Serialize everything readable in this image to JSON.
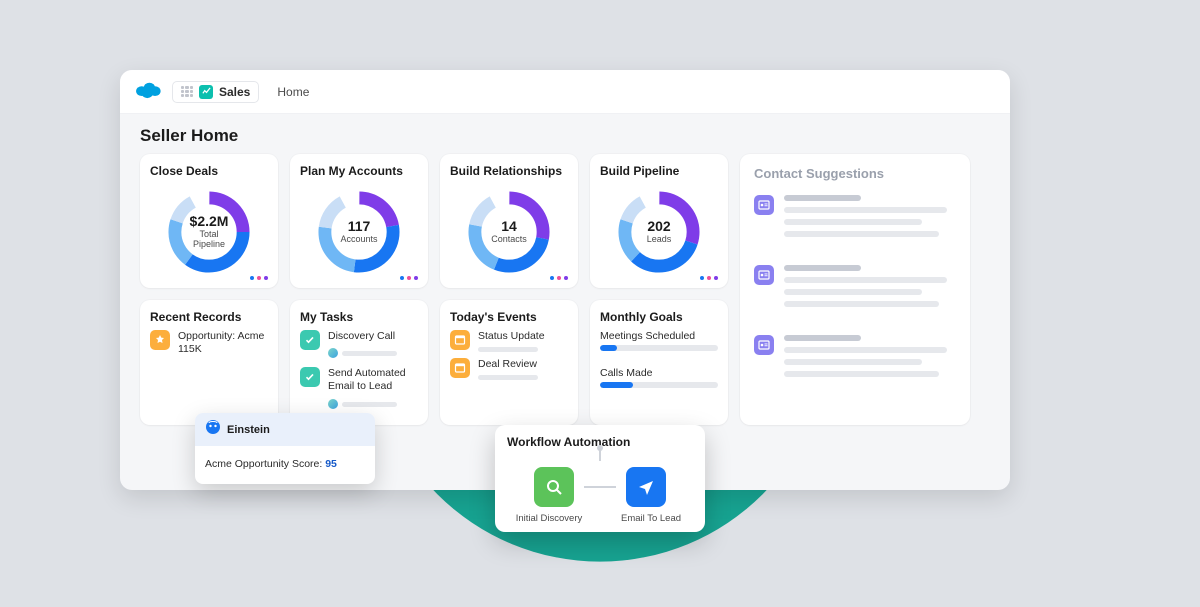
{
  "topbar": {
    "app_label": "Sales",
    "nav_home": "Home"
  },
  "page_title": "Seller Home",
  "kpis": [
    {
      "title": "Close Deals",
      "value": "$2.2M",
      "sub1": "Total",
      "sub2": "Pipeline"
    },
    {
      "title": "Plan My Accounts",
      "value": "117",
      "sub1": "Accounts",
      "sub2": ""
    },
    {
      "title": "Build Relationships",
      "value": "14",
      "sub1": "Contacts",
      "sub2": ""
    },
    {
      "title": "Build Pipeline",
      "value": "202",
      "sub1": "Leads",
      "sub2": ""
    }
  ],
  "recent": {
    "title": "Recent Records",
    "items": [
      {
        "label": "Opportunity: Acme 115K"
      }
    ]
  },
  "tasks": {
    "title": "My Tasks",
    "items": [
      {
        "label": "Discovery Call"
      },
      {
        "label": "Send Automated Email to Lead"
      }
    ]
  },
  "events": {
    "title": "Today's Events",
    "items": [
      {
        "label": "Status Update"
      },
      {
        "label": "Deal Review"
      }
    ]
  },
  "goals": {
    "title": "Monthly Goals",
    "items": [
      {
        "label": "Meetings Scheduled",
        "pct": 14
      },
      {
        "label": "Calls Made",
        "pct": 28
      }
    ]
  },
  "suggestions": {
    "title": "Contact Suggestions"
  },
  "einstein": {
    "title": "Einstein",
    "body_prefix": "Acme Opportunity Score: ",
    "score": "95"
  },
  "workflow": {
    "title": "Workflow Automation",
    "step1": "Initial Discovery",
    "step2": "Email To Lead"
  },
  "chart_data": [
    {
      "type": "pie",
      "title": "Close Deals",
      "center_value": "$2.2M",
      "center_label": "Total Pipeline",
      "series": [
        {
          "name": "segA",
          "color": "#7f3ce8",
          "value": 25
        },
        {
          "name": "segB",
          "color": "#1876f2",
          "value": 35
        },
        {
          "name": "segC",
          "color": "#6fb7f5",
          "value": 20
        },
        {
          "name": "segD",
          "color": "#c9def6",
          "value": 12
        },
        {
          "name": "gap",
          "color": "#ffffff",
          "value": 8
        }
      ]
    },
    {
      "type": "pie",
      "title": "Plan My Accounts",
      "center_value": "117",
      "center_label": "Accounts",
      "series": [
        {
          "name": "segA",
          "color": "#7f3ce8",
          "value": 22
        },
        {
          "name": "segB",
          "color": "#1876f2",
          "value": 30
        },
        {
          "name": "segC",
          "color": "#6fb7f5",
          "value": 25
        },
        {
          "name": "segD",
          "color": "#c9def6",
          "value": 15
        },
        {
          "name": "gap",
          "color": "#ffffff",
          "value": 8
        }
      ]
    },
    {
      "type": "pie",
      "title": "Build Relationships",
      "center_value": "14",
      "center_label": "Contacts",
      "series": [
        {
          "name": "segA",
          "color": "#7f3ce8",
          "value": 28
        },
        {
          "name": "segB",
          "color": "#1876f2",
          "value": 28
        },
        {
          "name": "segC",
          "color": "#6fb7f5",
          "value": 22
        },
        {
          "name": "segD",
          "color": "#c9def6",
          "value": 14
        },
        {
          "name": "gap",
          "color": "#ffffff",
          "value": 8
        }
      ]
    },
    {
      "type": "pie",
      "title": "Build Pipeline",
      "center_value": "202",
      "center_label": "Leads",
      "series": [
        {
          "name": "segA",
          "color": "#7f3ce8",
          "value": 30
        },
        {
          "name": "segB",
          "color": "#1876f2",
          "value": 32
        },
        {
          "name": "segC",
          "color": "#6fb7f5",
          "value": 18
        },
        {
          "name": "segD",
          "color": "#c9def6",
          "value": 12
        },
        {
          "name": "gap",
          "color": "#ffffff",
          "value": 8
        }
      ]
    }
  ]
}
